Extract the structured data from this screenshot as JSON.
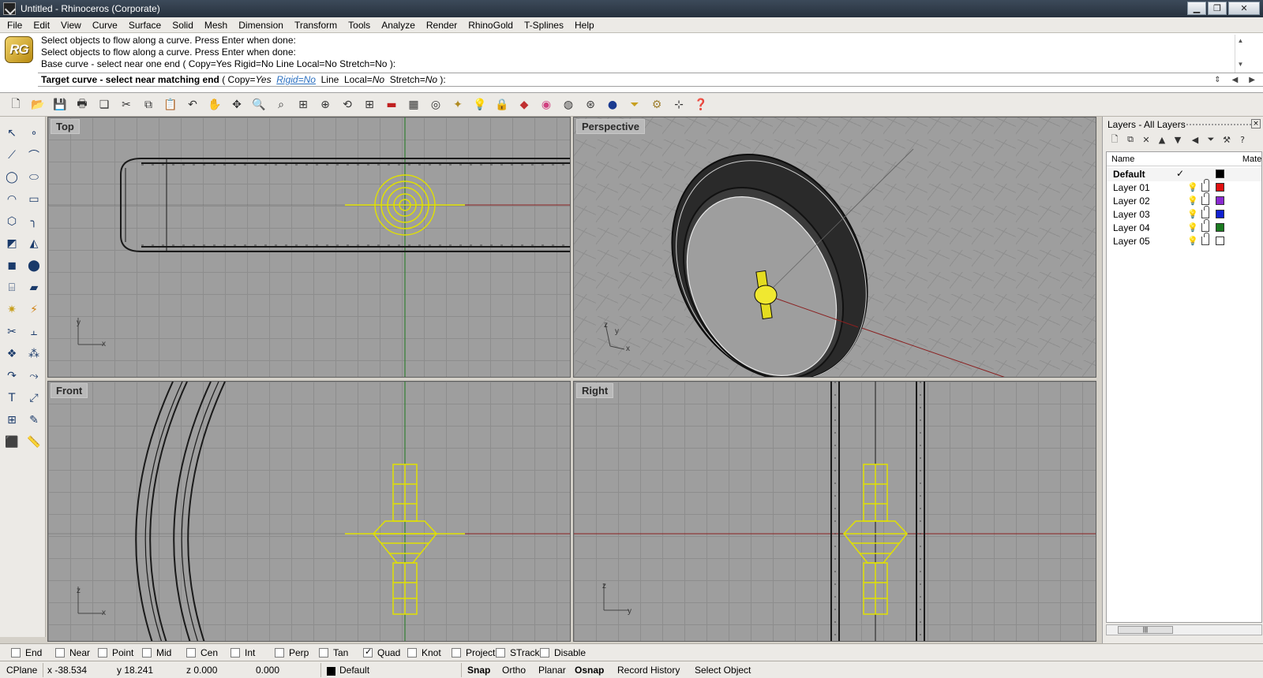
{
  "window": {
    "title": "Untitled - Rhinoceros (Corporate)"
  },
  "menu": [
    "File",
    "Edit",
    "View",
    "Curve",
    "Surface",
    "Solid",
    "Mesh",
    "Dimension",
    "Transform",
    "Tools",
    "Analyze",
    "Render",
    "RhinoGold",
    "T-Splines",
    "Help"
  ],
  "logo": {
    "text": "RG"
  },
  "command": {
    "history": [
      "Select objects to flow along a curve. Press Enter when done:",
      "Select objects to flow along a curve. Press Enter when done:",
      "Base curve - select near one end ( Copy=Yes  Rigid=No  Line  Local=No  Stretch=No ):"
    ],
    "prompt": "Target curve - select near matching end",
    "open": " ( ",
    "copy_key": "Copy=",
    "copy_val": "Yes",
    "rigid_link": "Rigid=No",
    "line": "Line",
    "local_key": "Local=",
    "local_val": "No",
    "stretch_key": "Stretch=",
    "stretch_val": "No",
    "close": " ):"
  },
  "viewports": {
    "top": "Top",
    "perspective": "Perspective",
    "front": "Front",
    "right": "Right"
  },
  "layers": {
    "title": "Layers - All Layers",
    "col_name": "Name",
    "col_material": "Mater",
    "rows": [
      {
        "name": "Default",
        "current": "✓",
        "color": "#000000"
      },
      {
        "name": "Layer 01",
        "color": "#e01010"
      },
      {
        "name": "Layer 02",
        "color": "#8a2ad0"
      },
      {
        "name": "Layer 03",
        "color": "#1020d0"
      },
      {
        "name": "Layer 04",
        "color": "#1a7a20"
      },
      {
        "name": "Layer 05",
        "color": "#ffffff"
      }
    ]
  },
  "osnap": [
    {
      "label": "End",
      "checked": false
    },
    {
      "label": "Near",
      "checked": false
    },
    {
      "label": "Point",
      "checked": false
    },
    {
      "label": "Mid",
      "checked": false
    },
    {
      "label": "Cen",
      "checked": false
    },
    {
      "label": "Int",
      "checked": false
    },
    {
      "label": "Perp",
      "checked": false
    },
    {
      "label": "Tan",
      "checked": false
    },
    {
      "label": "Quad",
      "checked": true
    },
    {
      "label": "Knot",
      "checked": false
    },
    {
      "label": "Project",
      "checked": false
    },
    {
      "label": "STrack",
      "checked": false
    },
    {
      "label": "Disable",
      "checked": false
    }
  ],
  "status": {
    "cplane": "CPlane",
    "x": "x -38.534",
    "y": "y 18.241",
    "z": "z 0.000",
    "extra": "0.000",
    "layer": "Default",
    "snap": "Snap",
    "ortho": "Ortho",
    "planar": "Planar",
    "osnap": "Osnap",
    "record_history": "Record History",
    "select_object": "Select Object"
  }
}
